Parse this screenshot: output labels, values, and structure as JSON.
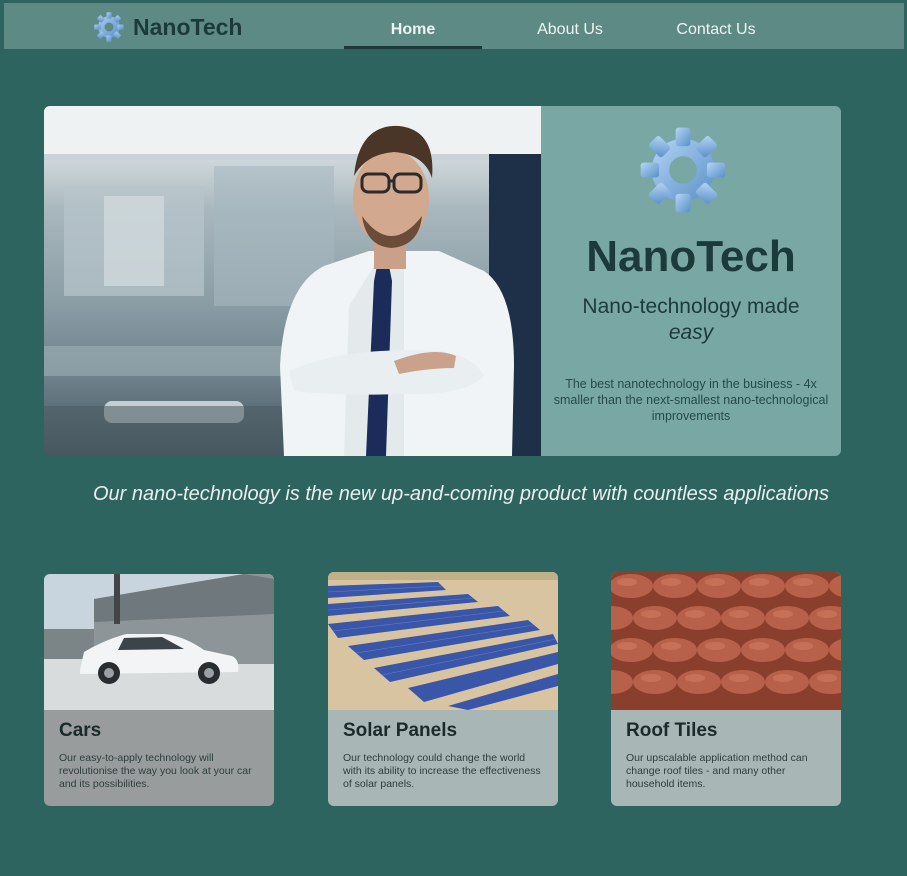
{
  "nav": {
    "brand": "NanoTech",
    "links": [
      "Home",
      "About Us",
      "Contact Us"
    ],
    "active": "Home"
  },
  "hero": {
    "image_alt": "Scientist in lab coat with arms crossed",
    "title": "NanoTech",
    "subtitle_line1": "Nano-technology made",
    "subtitle_line2": "easy",
    "description": "The best nanotechnology in the business - 4x smaller than the next-smallest nano-technological improvements"
  },
  "tagline": "Our nano-technology is the new up-and-coming product with countless applications",
  "cards": [
    {
      "title": "Cars",
      "description": "Our easy-to-apply technology will revolutionise the way you look at your car and its possibilities."
    },
    {
      "title": "Solar Panels",
      "description": "Our technology could change the world with its ability to increase the effectiveness of solar panels."
    },
    {
      "title": "Roof Tiles",
      "description": "Our upscalable application method can change roof tiles - and many other household items."
    }
  ],
  "colors": {
    "background": "#2e6460",
    "navbar": "#5e8a86",
    "hero_panel": "#79a8a4",
    "text_dark": "#1d3a3a",
    "gear": "#7aa9d6"
  },
  "icons": {
    "brand_logo": "gear-icon",
    "hero_logo": "gear-icon"
  }
}
